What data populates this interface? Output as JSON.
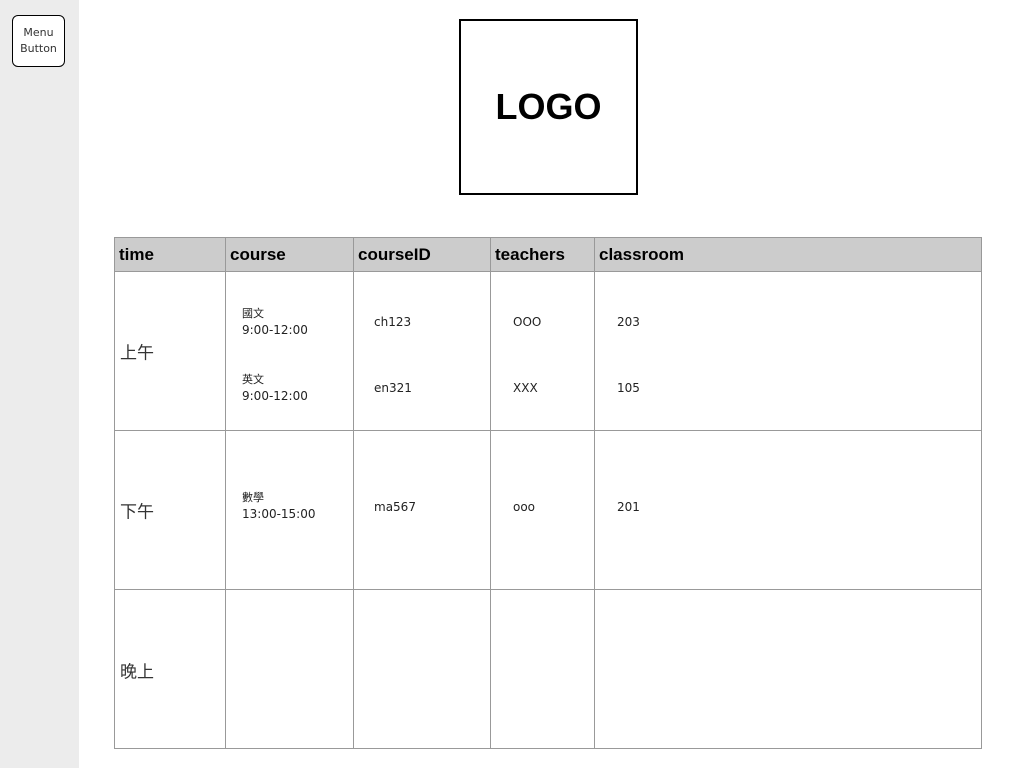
{
  "menu_button": {
    "line1": "Menu",
    "line2": "Button"
  },
  "logo": {
    "text": "LOGO"
  },
  "table": {
    "headers": {
      "time": "time",
      "course": "course",
      "courseID": "courseID",
      "teachers": "teachers",
      "classroom": "classroom"
    },
    "rows": [
      {
        "time": "上午",
        "entries": [
          {
            "course": "國文",
            "hours": "9:00-12:00",
            "id": "ch123",
            "teacher": "OOO",
            "room": "203"
          },
          {
            "course": "英文",
            "hours": "9:00-12:00",
            "id": "en321",
            "teacher": "XXX",
            "room": "105"
          }
        ]
      },
      {
        "time": "下午",
        "entries": [
          {
            "course": "數學",
            "hours": "13:00-15:00",
            "id": "ma567",
            "teacher": "ooo",
            "room": "201"
          }
        ]
      },
      {
        "time": "晚上",
        "entries": []
      }
    ]
  }
}
